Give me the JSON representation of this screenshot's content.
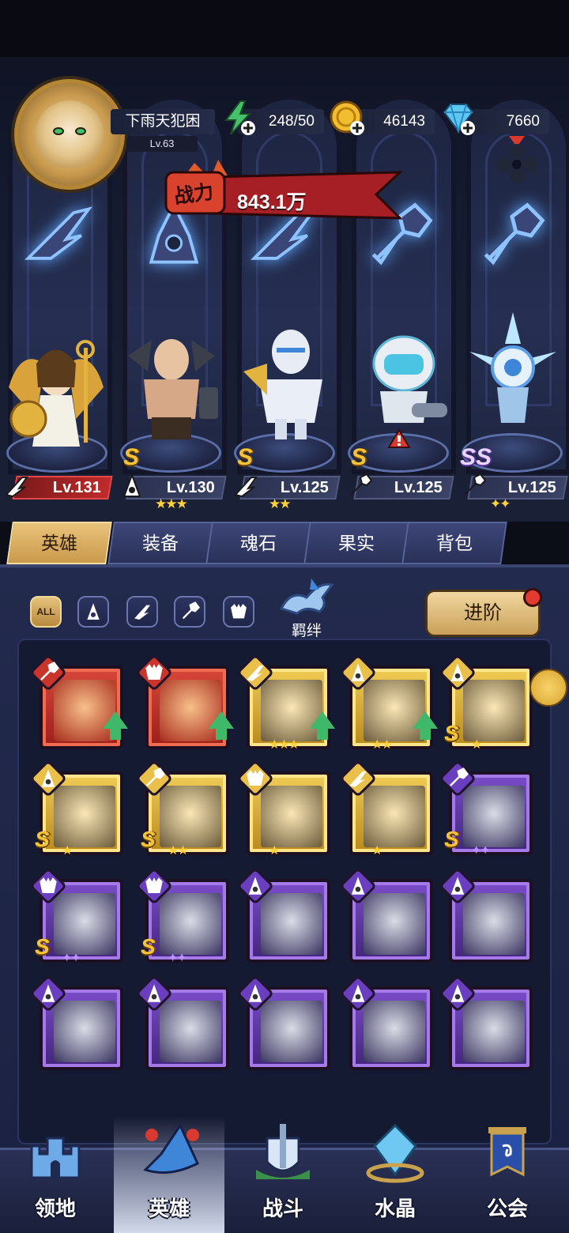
{
  "player": {
    "name": "下雨天犯困",
    "level": "Lv.63"
  },
  "resources": {
    "stamina": "248/50",
    "gold": "46143",
    "diamonds": "7660"
  },
  "power": {
    "label": "战力",
    "value": "843.1万"
  },
  "lineup": [
    {
      "level": "Lv.131",
      "class": "wing",
      "rank": "",
      "stars": "",
      "accent": "#c02b2b"
    },
    {
      "level": "Lv.130",
      "class": "support",
      "rank": "S",
      "stars": "★★★",
      "accent": "#3b4366"
    },
    {
      "level": "Lv.125",
      "class": "wing",
      "rank": "S",
      "stars": "★★",
      "accent": "#3b4366"
    },
    {
      "level": "Lv.125",
      "class": "wrench",
      "rank": "S",
      "stars": "",
      "accent": "#3b4366"
    },
    {
      "level": "Lv.125",
      "class": "wrench",
      "rank": "SS",
      "stars": "✦✦",
      "accent": "#3b4366"
    }
  ],
  "tabs": [
    "英雄",
    "装备",
    "魂石",
    "果实",
    "背包"
  ],
  "filters": {
    "all": "ALL",
    "bond": "羁绊",
    "advance": "进阶"
  },
  "heroes": [
    {
      "frame": "red",
      "class": "wrench",
      "upgrade": true,
      "rank": "",
      "stars": ""
    },
    {
      "frame": "red",
      "class": "beast",
      "upgrade": true,
      "rank": "",
      "stars": ""
    },
    {
      "frame": "gold",
      "class": "wing",
      "upgrade": true,
      "rank": "",
      "stars": "★★★"
    },
    {
      "frame": "gold",
      "class": "support",
      "upgrade": true,
      "rank": "",
      "stars": "★★"
    },
    {
      "frame": "gold",
      "class": "support",
      "upgrade": false,
      "rank": "S",
      "stars": "★"
    },
    {
      "frame": "gold",
      "class": "support",
      "upgrade": false,
      "rank": "S",
      "stars": "★"
    },
    {
      "frame": "gold",
      "class": "wrench",
      "upgrade": false,
      "rank": "S",
      "stars": "★★"
    },
    {
      "frame": "gold",
      "class": "beast",
      "upgrade": false,
      "rank": "",
      "stars": "★"
    },
    {
      "frame": "gold",
      "class": "wing",
      "upgrade": false,
      "rank": "",
      "stars": "★"
    },
    {
      "frame": "purple",
      "class": "wrench",
      "upgrade": false,
      "rank": "S",
      "stars": "✦✦"
    },
    {
      "frame": "purple",
      "class": "beast",
      "upgrade": false,
      "rank": "S",
      "stars": "✦✦"
    },
    {
      "frame": "purple",
      "class": "beast",
      "upgrade": false,
      "rank": "S",
      "stars": "✦✦"
    },
    {
      "frame": "purple",
      "class": "support",
      "upgrade": false,
      "rank": "",
      "stars": ""
    },
    {
      "frame": "purple",
      "class": "support",
      "upgrade": false,
      "rank": "",
      "stars": ""
    },
    {
      "frame": "purple",
      "class": "support",
      "upgrade": false,
      "rank": "",
      "stars": ""
    },
    {
      "frame": "purple",
      "class": "support",
      "upgrade": false,
      "rank": "",
      "stars": ""
    },
    {
      "frame": "purple",
      "class": "support",
      "upgrade": false,
      "rank": "",
      "stars": ""
    },
    {
      "frame": "purple",
      "class": "support",
      "upgrade": false,
      "rank": "",
      "stars": ""
    },
    {
      "frame": "purple",
      "class": "support",
      "upgrade": false,
      "rank": "",
      "stars": ""
    },
    {
      "frame": "purple",
      "class": "support",
      "upgrade": false,
      "rank": "",
      "stars": ""
    }
  ],
  "nav": [
    {
      "label": "领地",
      "icon": "castle-icon"
    },
    {
      "label": "英雄",
      "icon": "wizard-hat-icon",
      "active": true
    },
    {
      "label": "战斗",
      "icon": "sword-shield-icon"
    },
    {
      "label": "水晶",
      "icon": "crystal-icon"
    },
    {
      "label": "公会",
      "icon": "guild-banner-icon"
    }
  ],
  "colors": {
    "gold_accent": "#e9c27a",
    "red_frame": "#d8473a",
    "gold_frame": "#f0cc55",
    "purple_frame": "#7b4dc9",
    "upgrade_green": "#3fb86a"
  }
}
